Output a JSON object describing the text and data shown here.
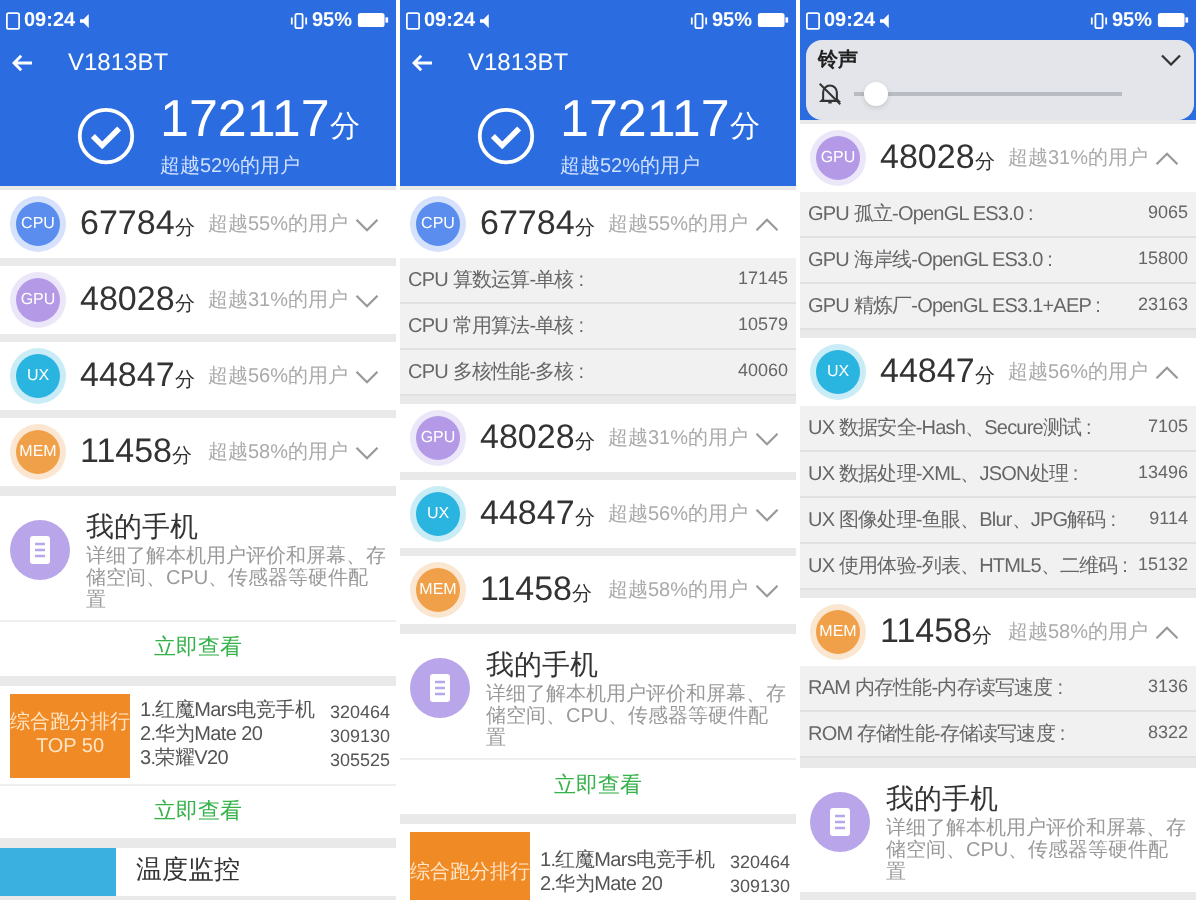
{
  "panels": [
    {
      "status_bar": {
        "time": "09:24",
        "battery": "95%"
      },
      "header": {
        "title": "V1813BT",
        "score": "172117",
        "unit": "分",
        "subtitle": "超越52%的用户"
      },
      "sections": [
        {
          "kind": "score",
          "badge": "CPU",
          "color": "#5b8def",
          "score": "67784",
          "unit": "分",
          "percentile": "超越55%的用户",
          "expanded": false
        },
        {
          "kind": "score",
          "badge": "GPU",
          "color": "#b49ae6",
          "score": "48028",
          "unit": "分",
          "percentile": "超越31%的用户",
          "expanded": false
        },
        {
          "kind": "score",
          "badge": "UX",
          "color": "#2ab4e0",
          "score": "44847",
          "unit": "分",
          "percentile": "超越56%的用户",
          "expanded": false
        },
        {
          "kind": "score",
          "badge": "MEM",
          "color": "#f0a048",
          "score": "11458",
          "unit": "分",
          "percentile": "超越58%的用户",
          "expanded": false
        },
        {
          "kind": "card",
          "title": "我的手机",
          "description": "详细了解本机用户评价和屏幕、存储空间、CPU、传感器等硬件配置",
          "action": "立即查看"
        },
        {
          "kind": "ranking",
          "badge_lines": [
            "综合跑分排行",
            "TOP 50"
          ],
          "items": [
            {
              "name": "1.红魔Mars电竞手机",
              "score": "320464"
            },
            {
              "name": "2.华为Mate 20",
              "score": "309130"
            },
            {
              "name": "3.荣耀V20",
              "score": "305525"
            }
          ],
          "action": "立即查看"
        },
        {
          "kind": "teaser",
          "title": "温度监控"
        }
      ]
    },
    {
      "status_bar": {
        "time": "09:24",
        "battery": "95%"
      },
      "header": {
        "title": "V1813BT",
        "score": "172117",
        "unit": "分",
        "subtitle": "超越52%的用户"
      },
      "sections": [
        {
          "kind": "score",
          "badge": "CPU",
          "color": "#5b8def",
          "score": "67784",
          "unit": "分",
          "percentile": "超越55%的用户",
          "expanded": true,
          "details": [
            {
              "label": "CPU 算数运算-单核 :",
              "value": "17145"
            },
            {
              "label": "CPU 常用算法-单核 :",
              "value": "10579"
            },
            {
              "label": "CPU 多核性能-多核 :",
              "value": "40060"
            }
          ]
        },
        {
          "kind": "score",
          "badge": "GPU",
          "color": "#b49ae6",
          "score": "48028",
          "unit": "分",
          "percentile": "超越31%的用户",
          "expanded": false
        },
        {
          "kind": "score",
          "badge": "UX",
          "color": "#2ab4e0",
          "score": "44847",
          "unit": "分",
          "percentile": "超越56%的用户",
          "expanded": false
        },
        {
          "kind": "score",
          "badge": "MEM",
          "color": "#f0a048",
          "score": "11458",
          "unit": "分",
          "percentile": "超越58%的用户",
          "expanded": false
        },
        {
          "kind": "card",
          "title": "我的手机",
          "description": "详细了解本机用户评价和屏幕、存储空间、CPU、传感器等硬件配置",
          "action": "立即查看"
        },
        {
          "kind": "ranking",
          "badge_lines": [
            "综合跑分排行"
          ],
          "items": [
            {
              "name": "1.红魔Mars电竞手机",
              "score": "320464"
            },
            {
              "name": "2.华为Mate 20",
              "score": "309130"
            }
          ]
        }
      ]
    },
    {
      "status_bar": {
        "time": "09:24",
        "battery": "95%"
      },
      "volume_popup": {
        "label": "铃声",
        "level": 0.04
      },
      "sections": [
        {
          "kind": "score",
          "badge": "GPU",
          "color": "#b49ae6",
          "score": "48028",
          "unit": "分",
          "percentile": "超越31%的用户",
          "expanded": true,
          "details": [
            {
              "label": "GPU 孤立-OpenGL ES3.0 :",
              "value": "9065"
            },
            {
              "label": "GPU 海岸线-OpenGL ES3.0 :",
              "value": "15800"
            },
            {
              "label": "GPU 精炼厂-OpenGL ES3.1+AEP :",
              "value": "23163"
            }
          ]
        },
        {
          "kind": "score",
          "badge": "UX",
          "color": "#2ab4e0",
          "score": "44847",
          "unit": "分",
          "percentile": "超越56%的用户",
          "expanded": true,
          "details": [
            {
              "label": "UX 数据安全-Hash、Secure测试 :",
              "value": "7105"
            },
            {
              "label": "UX 数据处理-XML、JSON处理 :",
              "value": "13496"
            },
            {
              "label": "UX 图像处理-鱼眼、Blur、JPG解码 :",
              "value": "9114"
            },
            {
              "label": "UX 使用体验-列表、HTML5、二维码 :",
              "value": "15132"
            }
          ]
        },
        {
          "kind": "score",
          "badge": "MEM",
          "color": "#f0a048",
          "score": "11458",
          "unit": "分",
          "percentile": "超越58%的用户",
          "expanded": true,
          "details": [
            {
              "label": "RAM 内存性能-内存读写速度 :",
              "value": "3136"
            },
            {
              "label": "ROM 存储性能-存储读写速度 :",
              "value": "8322"
            }
          ]
        },
        {
          "kind": "card",
          "title": "我的手机",
          "description": "详细了解本机用户评价和屏幕、存储空间、CPU、传感器等硬件配置"
        }
      ]
    }
  ]
}
